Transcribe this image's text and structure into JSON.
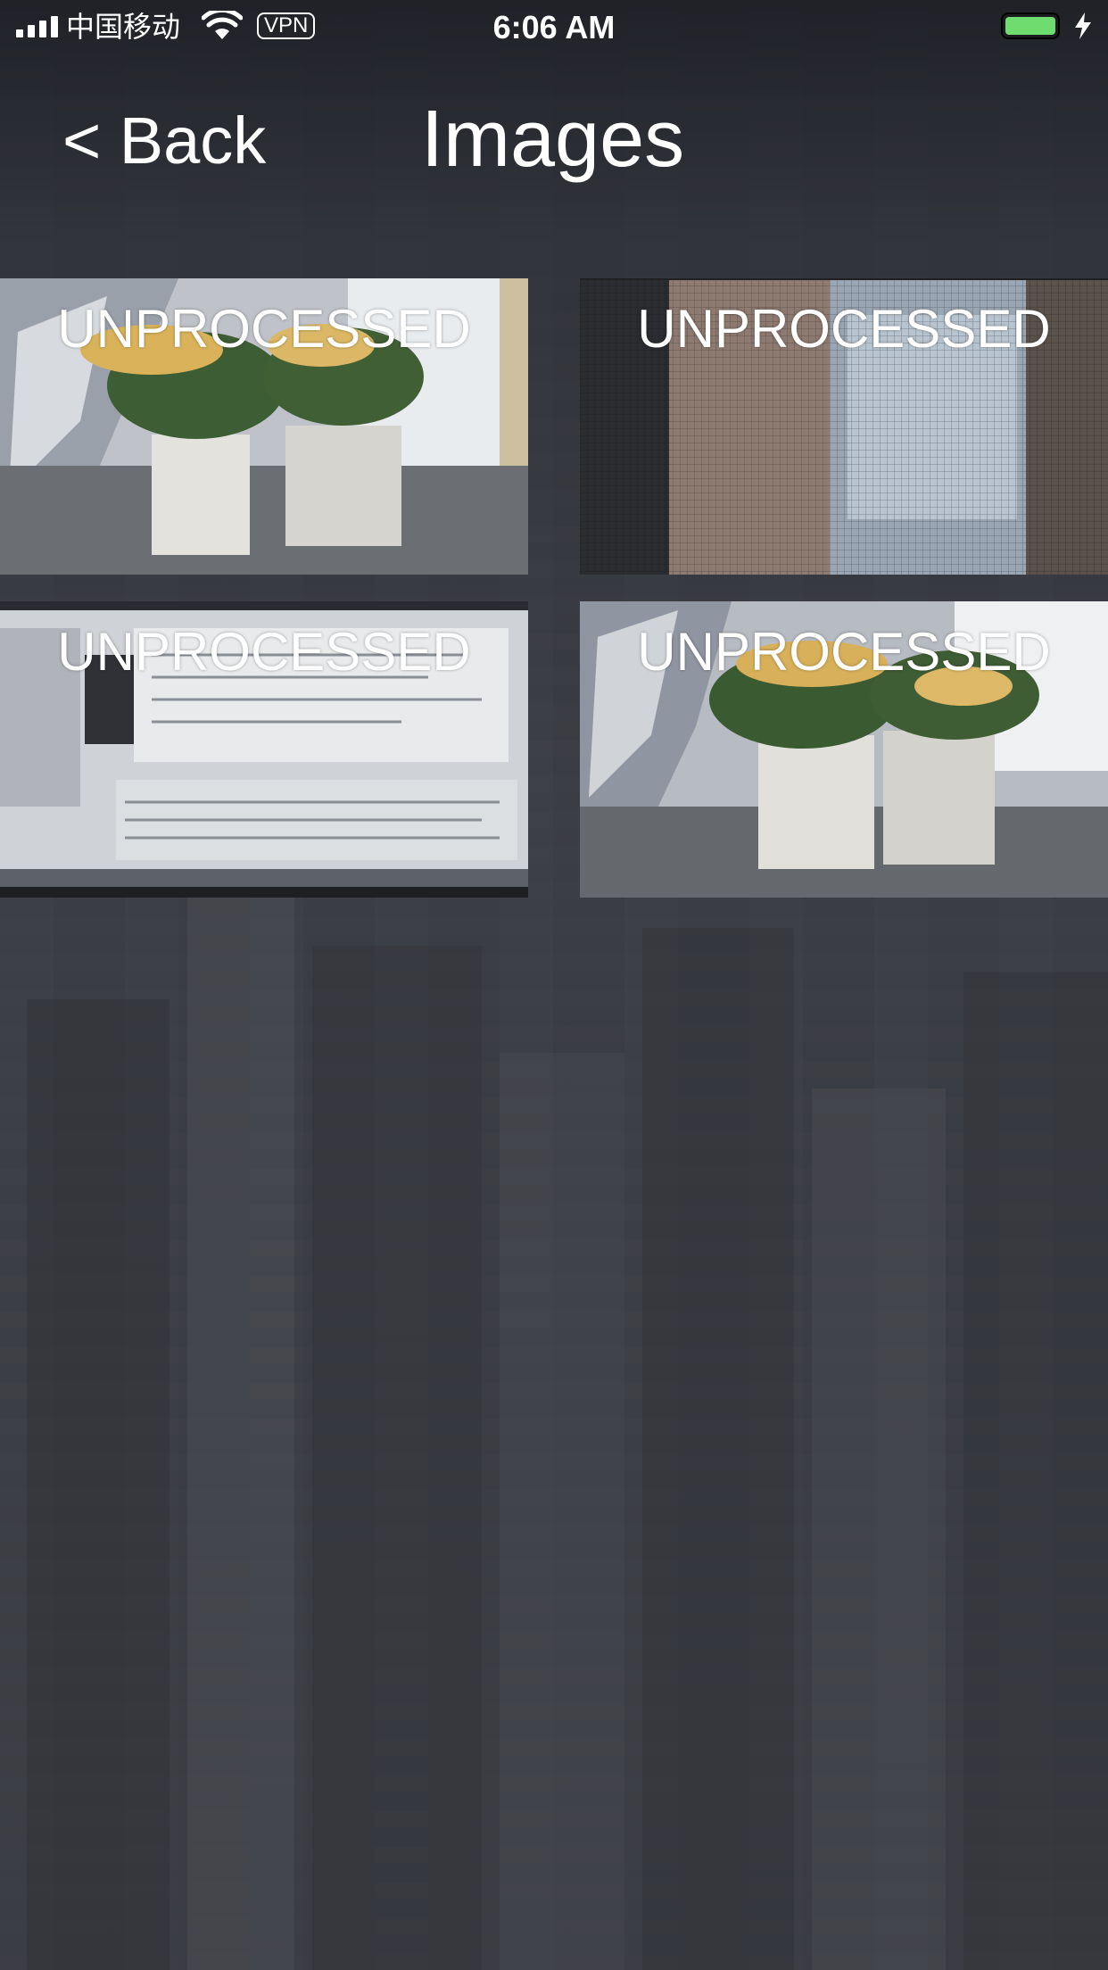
{
  "status_bar": {
    "carrier": "中国移动",
    "vpn": "VPN",
    "time": "6:06 AM",
    "battery_color": "#6fdc6f",
    "icons": [
      "signal-icon",
      "wifi-icon",
      "vpn-badge",
      "battery-icon",
      "charging-bolt-icon"
    ]
  },
  "nav": {
    "back_label": "< Back",
    "title": "Images"
  },
  "grid": {
    "items": [
      {
        "label": "UNPROCESSED",
        "scene": "flower-pots-window-left"
      },
      {
        "label": "UNPROCESSED",
        "scene": "window-mesh-buildings"
      },
      {
        "label": "UNPROCESSED",
        "scene": "laptop-screen-code"
      },
      {
        "label": "UNPROCESSED",
        "scene": "flower-pots-window-right"
      }
    ]
  }
}
